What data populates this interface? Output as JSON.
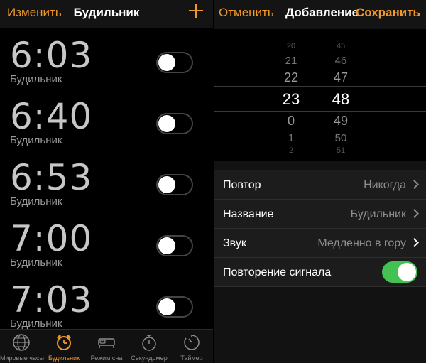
{
  "left": {
    "nav": {
      "edit_label": "Изменить",
      "title": "Будильник"
    },
    "alarms": [
      {
        "time": "6:03",
        "label": "Будильник"
      },
      {
        "time": "6:40",
        "label": "Будильник"
      },
      {
        "time": "6:53",
        "label": "Будильник"
      },
      {
        "time": "7:00",
        "label": "Будильник"
      },
      {
        "time": "7:03",
        "label": "Будильник"
      }
    ],
    "tabs": [
      {
        "label": "Мировые часы",
        "icon": "globe-icon"
      },
      {
        "label": "Будильник",
        "icon": "alarm-clock-icon"
      },
      {
        "label": "Режим сна",
        "icon": "bed-icon"
      },
      {
        "label": "Секундомер",
        "icon": "stopwatch-icon"
      },
      {
        "label": "Таймер",
        "icon": "timer-icon"
      }
    ]
  },
  "right": {
    "nav": {
      "cancel_label": "Отменить",
      "title": "Добавление",
      "save_label": "Сохранить"
    },
    "picker": {
      "hours": [
        "20",
        "21",
        "22",
        "23",
        "0",
        "1",
        "2"
      ],
      "minutes": [
        "45",
        "46",
        "47",
        "48",
        "49",
        "50",
        "51"
      ],
      "selected_hour": "23",
      "selected_minute": "48"
    },
    "settings": {
      "repeat_label": "Повтор",
      "repeat_value": "Никогда",
      "name_label": "Название",
      "name_value": "Будильник",
      "sound_label": "Звук",
      "sound_value": "Медленно в гору",
      "snooze_label": "Повторение сигнала",
      "snooze_on": true
    }
  },
  "colors": {
    "accent": "#f0982a",
    "toggle_on": "#43c152"
  }
}
